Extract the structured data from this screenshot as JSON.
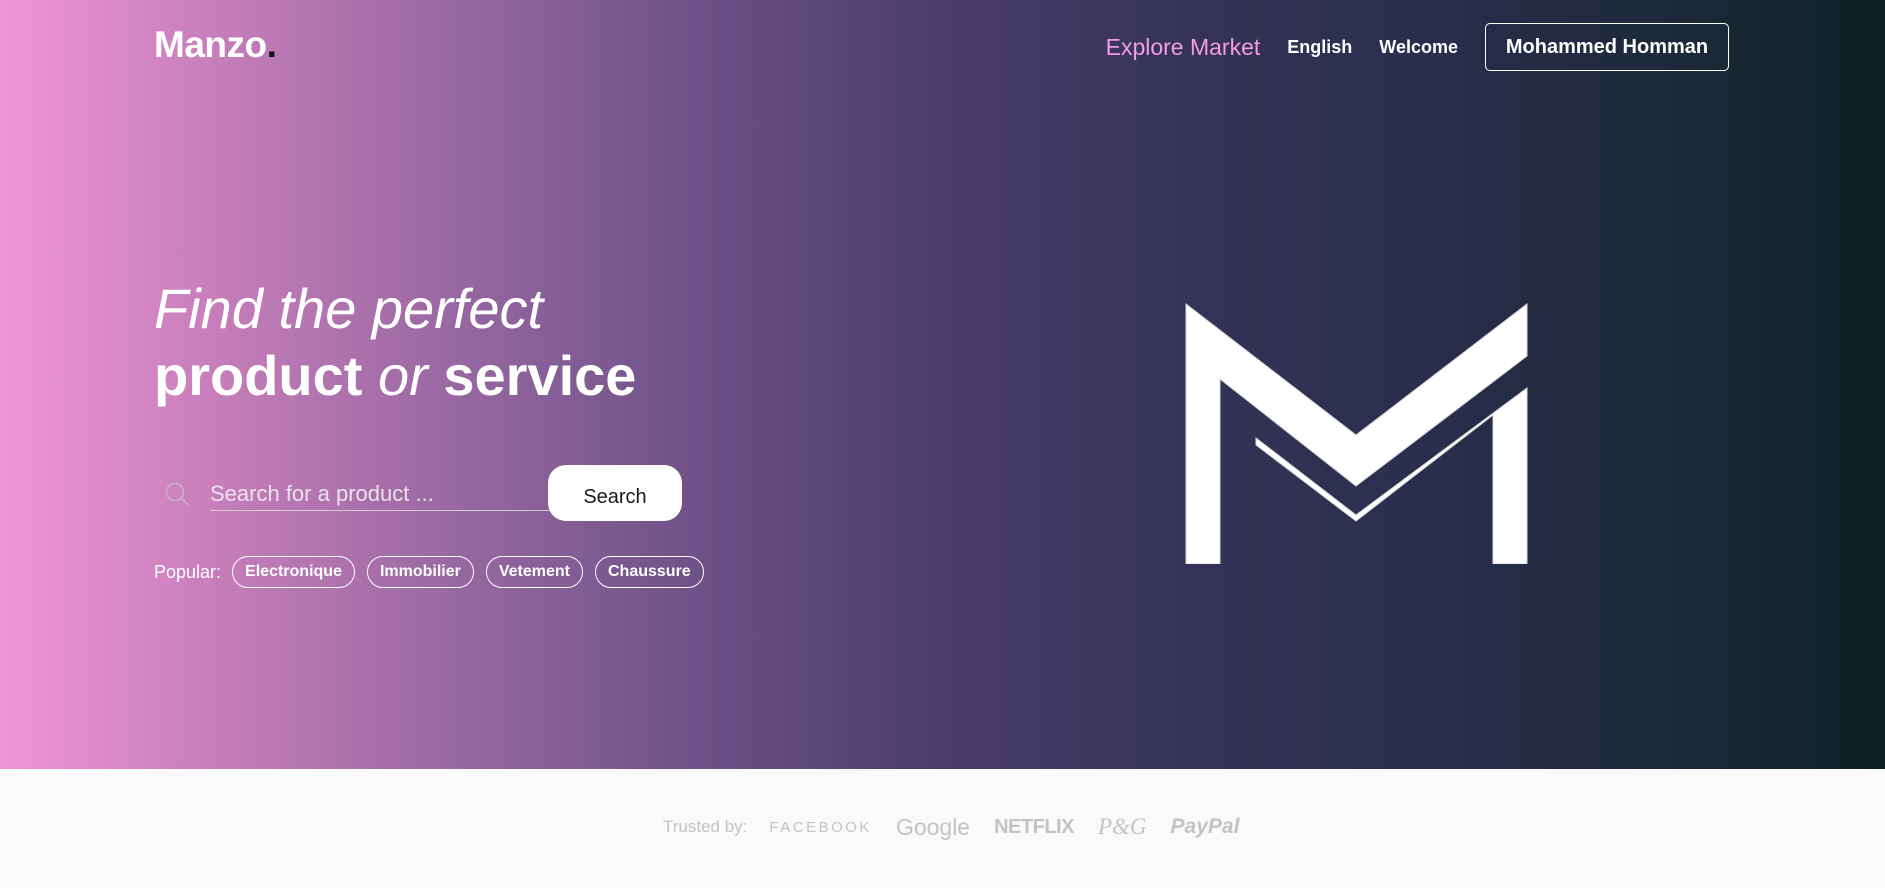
{
  "logo": {
    "text": "Manzo",
    "dot": "."
  },
  "nav": {
    "explore": "Explore Market",
    "language": "English",
    "welcome": "Welcome",
    "user": "Mohammed Homman"
  },
  "hero": {
    "line1": "Find the perfect",
    "word_product": "product",
    "word_or": "or",
    "word_service": "service"
  },
  "search": {
    "placeholder": "Search for a product ...",
    "value": "",
    "button_label": "Search",
    "icon": "search-icon"
  },
  "popular": {
    "label": "Popular:",
    "tags": [
      "Electronique",
      "Immobilier",
      "Vetement",
      "Chaussure"
    ]
  },
  "trusted": {
    "label": "Trusted by:",
    "companies": [
      "FACEBOOK",
      "Google",
      "NETFLIX",
      "P&G",
      "PayPal"
    ]
  },
  "colors": {
    "gradient_start": "#f094d9",
    "gradient_end": "#0c2124",
    "accent": "#f39be6",
    "footer_bg": "#fafafa",
    "footer_text": "#c3c3c3"
  }
}
